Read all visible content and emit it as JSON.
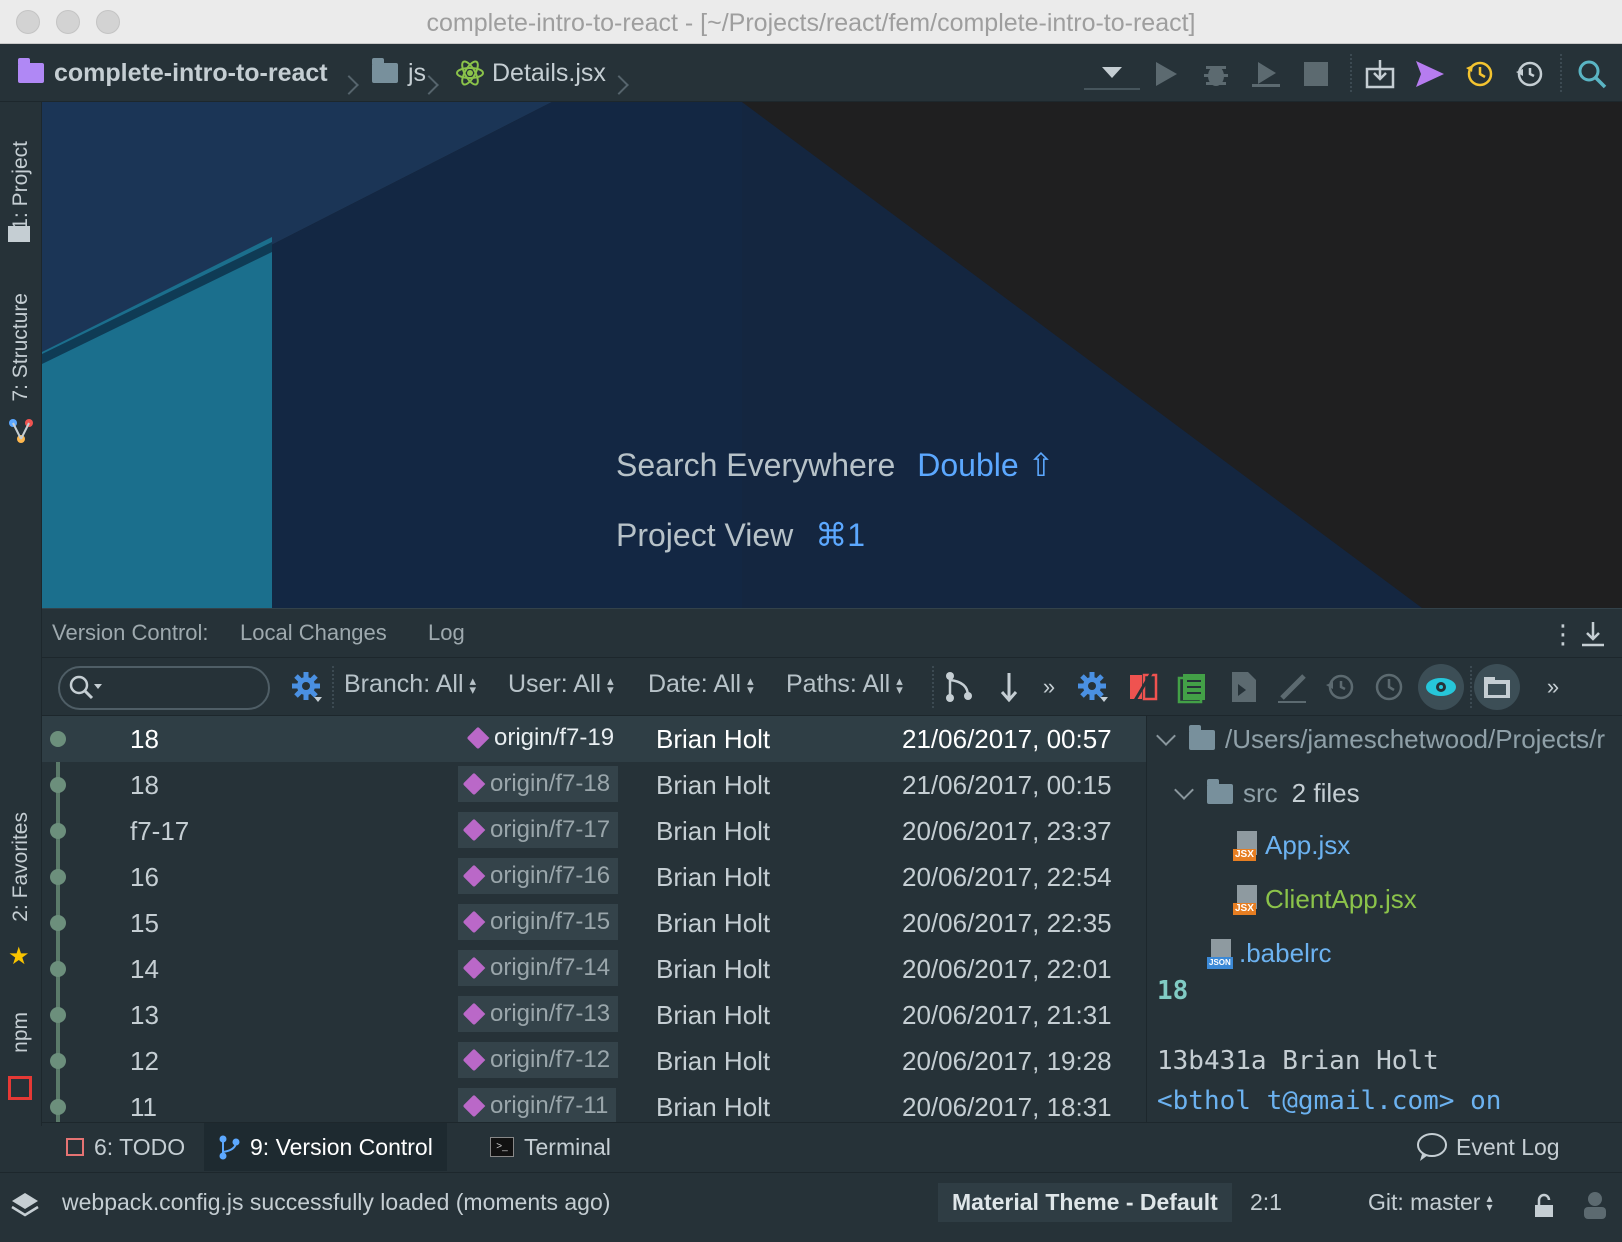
{
  "window": {
    "title": "complete-intro-to-react - [~/Projects/react/fem/complete-intro-to-react]"
  },
  "breadcrumb": {
    "project": "complete-intro-to-react",
    "folder": "js",
    "file": "Details.jsx"
  },
  "toolbar_icons": [
    "run-config-dropdown-icon",
    "run-icon",
    "debug-icon",
    "coverage-icon",
    "stop-icon",
    "vcs-update-icon",
    "vcs-push-icon",
    "vcs-history-icon",
    "vcs-revert-icon",
    "search-icon"
  ],
  "left_tool_tabs": {
    "project": "1: Project",
    "structure": "7: Structure",
    "favorites": "2: Favorites",
    "npm": "npm"
  },
  "editor_hints": {
    "search_label": "Search Everywhere",
    "search_key": "Double ⇧",
    "project_label": "Project View",
    "project_key": "⌘1"
  },
  "version_control": {
    "title": "Version Control:",
    "tabs": [
      "Local Changes",
      "Log"
    ]
  },
  "log_toolbar": {
    "filters": {
      "branch": "Branch: All",
      "user": "User: All",
      "date": "Date: All",
      "paths": "Paths: All"
    }
  },
  "commits": [
    {
      "subject": "18",
      "tag": "origin/f7-19",
      "author": "Brian Holt",
      "date": "21/06/2017, 00:57",
      "selected": true
    },
    {
      "subject": "18",
      "tag": "origin/f7-18",
      "author": "Brian Holt",
      "date": "21/06/2017, 00:15"
    },
    {
      "subject": "f7-17",
      "tag": "origin/f7-17",
      "author": "Brian Holt",
      "date": "20/06/2017, 23:37"
    },
    {
      "subject": "16",
      "tag": "origin/f7-16",
      "author": "Brian Holt",
      "date": "20/06/2017, 22:54"
    },
    {
      "subject": "15",
      "tag": "origin/f7-15",
      "author": "Brian Holt",
      "date": "20/06/2017, 22:35"
    },
    {
      "subject": "14",
      "tag": "origin/f7-14",
      "author": "Brian Holt",
      "date": "20/06/2017, 22:01"
    },
    {
      "subject": "13",
      "tag": "origin/f7-13",
      "author": "Brian Holt",
      "date": "20/06/2017, 21:31"
    },
    {
      "subject": "12",
      "tag": "origin/f7-12",
      "author": "Brian Holt",
      "date": "20/06/2017, 19:28"
    },
    {
      "subject": "11",
      "tag": "origin/f7-11",
      "author": "Brian Holt",
      "date": "20/06/2017, 18:31"
    }
  ],
  "details": {
    "root_path": "/Users/jameschetwood/Projects/r",
    "src_folder": "src",
    "src_count": "2 files",
    "files": [
      "App.jsx",
      "ClientApp.jsx"
    ],
    "root_file": ".babelrc",
    "commit_subject": "18",
    "commit_line1": "13b431a Brian Holt",
    "commit_line2": "<bthol t@gmail.com> on"
  },
  "bottom_tabs": {
    "todo": "6: TODO",
    "vcs": "9: Version Control",
    "terminal": "Terminal",
    "event_log": "Event Log"
  },
  "status": {
    "message": "webpack.config.js successfully loaded (moments ago)",
    "theme": "Material Theme - Default",
    "position": "2:1",
    "git": "Git: master"
  },
  "colors": {
    "bg": "#263238",
    "accent_blue": "#5ca8ff",
    "tag_purple": "#ba68c8",
    "file_blue": "#6cb2f0",
    "file_green": "#8bc34a",
    "commit_cyan": "#80cbc4"
  }
}
